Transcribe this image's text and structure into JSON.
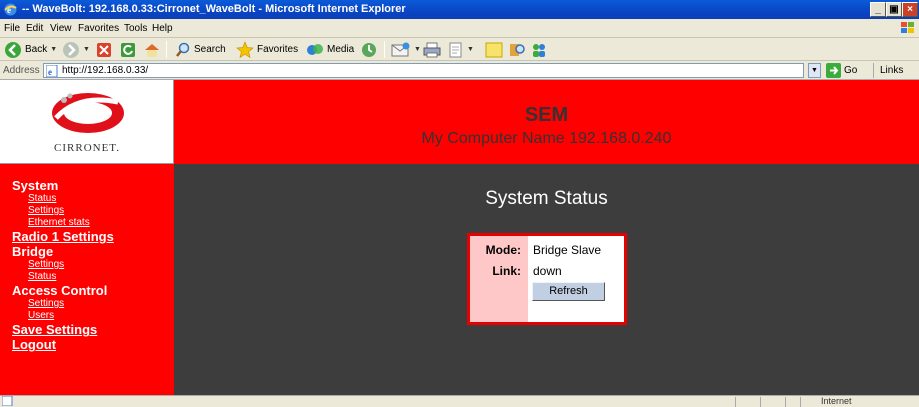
{
  "window": {
    "title": "-- WaveBolt: 192.168.0.33:Cirronet_WaveBolt - Microsoft Internet Explorer",
    "min": "_",
    "max": "▣",
    "close": "×"
  },
  "menu": [
    "File",
    "Edit",
    "View",
    "Favorites",
    "Tools",
    "Help"
  ],
  "toolbar": {
    "back": "Back",
    "search": "Search",
    "favorites": "Favorites",
    "media": "Media"
  },
  "address": {
    "label": "Address",
    "url": "http://192.168.0.33/",
    "go": "Go",
    "links": "Links"
  },
  "logo": {
    "text": "CIRRONET."
  },
  "header": {
    "title": "SEM",
    "subtitle": "My Computer Name  192.168.0.240"
  },
  "nav": {
    "system": "System",
    "status": "Status",
    "settings": "Settings",
    "ethernet_stats": "Ethernet stats",
    "radio1": "Radio 1 Settings",
    "bridge": "Bridge",
    "bridge_settings": "Settings",
    "bridge_status": "Status",
    "access_control": "Access Control",
    "ac_settings": "Settings",
    "ac_users": "Users",
    "save_settings": "Save Settings",
    "logout": "Logout"
  },
  "main": {
    "title": "System Status",
    "mode_label": "Mode:",
    "mode_value": "Bridge Slave",
    "link_label": "Link:",
    "link_value": "down",
    "refresh": "Refresh"
  },
  "statusbar": {
    "zone": "Internet"
  },
  "colors": {
    "accent_red": "#fe0000",
    "page_bg": "#3d3d3d",
    "xp_blue": "#0a45c4"
  }
}
